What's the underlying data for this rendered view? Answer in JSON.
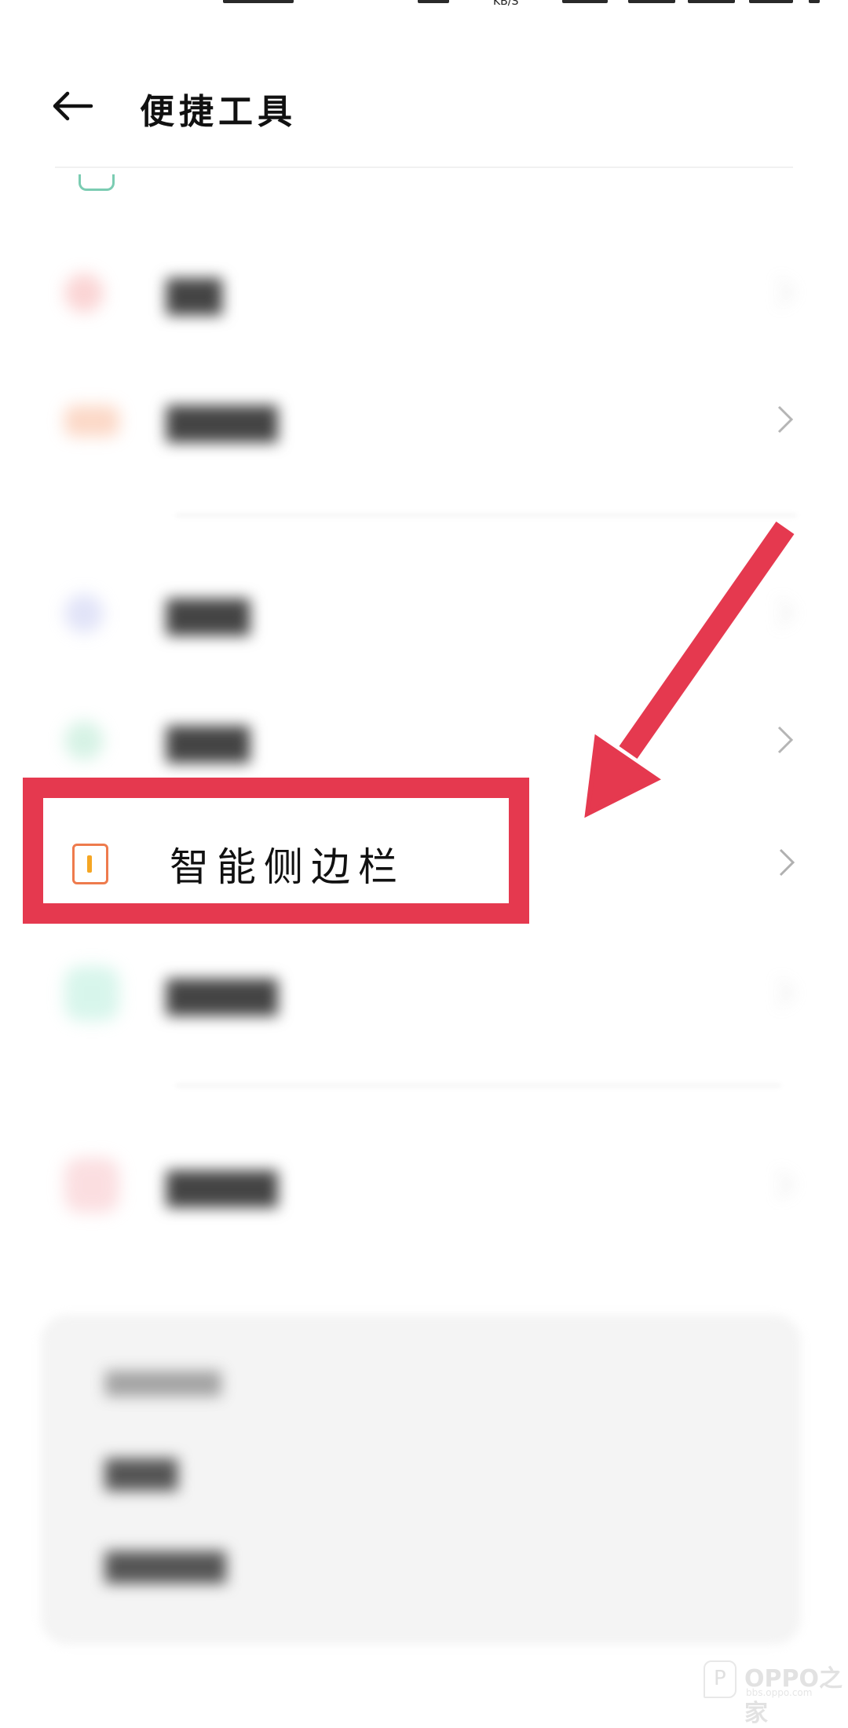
{
  "status_bar": {
    "speed_unit": "KB/S"
  },
  "header": {
    "title": "便捷工具",
    "back_icon": "arrow-left-icon"
  },
  "highlighted_item": {
    "label": "智能侧边栏",
    "icon": "sidebar-icon",
    "icon_color": "#ee7b4d",
    "accent": "#f5a623"
  },
  "highlight_color": "#e5394f",
  "blurred_items": [
    {
      "icon_color": "#f7b2b2"
    },
    {
      "icon_color": "#f9b99a"
    },
    {
      "icon_color": "#c9cdf2"
    },
    {
      "icon_color": "#b5e8d0"
    },
    {
      "icon_color": "#b8eedc"
    },
    {
      "icon_color": "#f8c4c8"
    }
  ],
  "watermark": {
    "brand": "OPPO之家",
    "url": "bbs.oppo.com"
  }
}
